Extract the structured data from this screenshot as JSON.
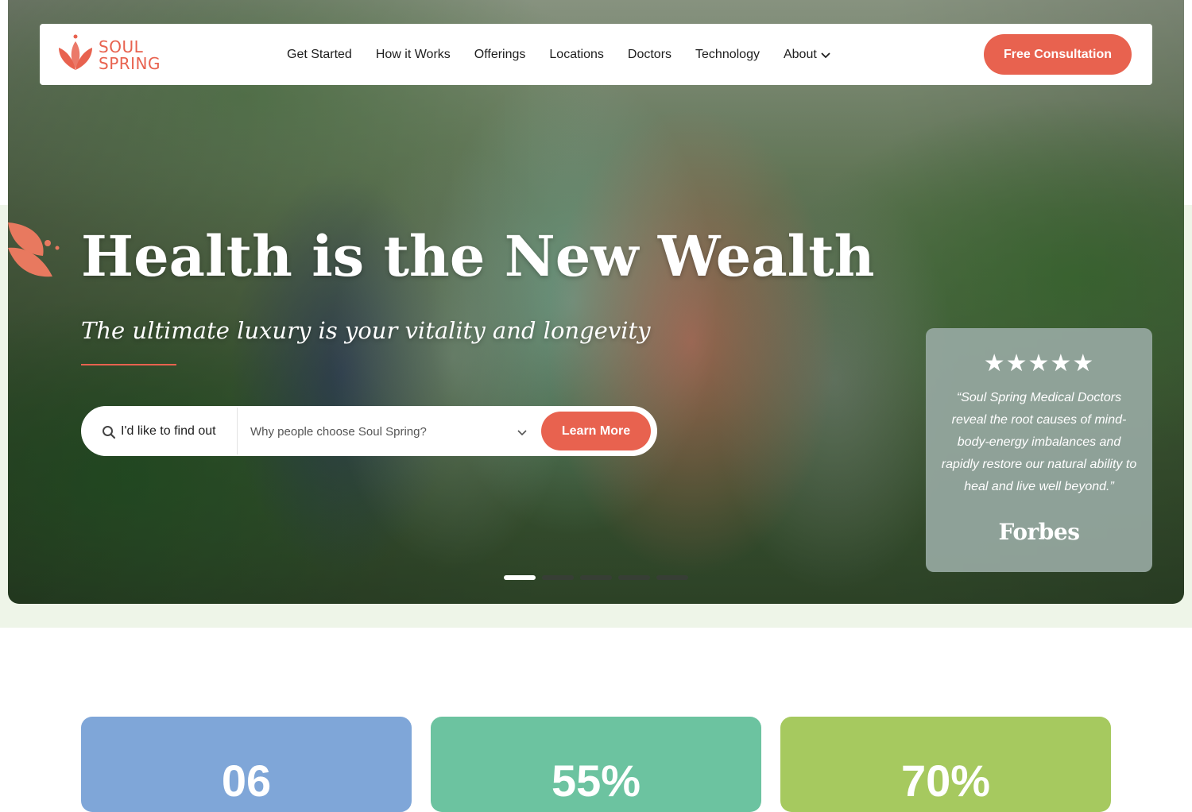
{
  "brand": {
    "name_line1": "SOUL",
    "name_line2": "SPRING",
    "accent_color": "#e8624f"
  },
  "nav": {
    "items": [
      {
        "label": "Get Started"
      },
      {
        "label": "How it Works"
      },
      {
        "label": "Offerings"
      },
      {
        "label": "Locations"
      },
      {
        "label": "Doctors"
      },
      {
        "label": "Technology"
      },
      {
        "label": "About",
        "has_dropdown": true,
        "icon": "chevron-down-icon"
      }
    ],
    "cta_label": "Free Consultation"
  },
  "hero": {
    "title": "Health is the New Wealth",
    "subtitle": "The ultimate luxury is your vitality and longevity",
    "search": {
      "icon": "search-icon",
      "label": "I'd like to find out",
      "selected_option": "Why people choose Soul Spring?",
      "button_label": "Learn More"
    },
    "carousel": {
      "slide_count": 5,
      "active_index": 0
    }
  },
  "testimonial": {
    "stars": "★★★★★",
    "rating": 5,
    "quote": "“Soul Spring Medical Doctors reveal the root causes of mind-body-energy imbalances and rapidly restore our natural ability to heal and live well beyond.”",
    "source": "Forbes"
  },
  "stats": [
    {
      "value": "06",
      "color": "#7fa6d8"
    },
    {
      "value": "55%",
      "color": "#6cc3a0"
    },
    {
      "value": "70%",
      "color": "#a6c95f"
    }
  ]
}
